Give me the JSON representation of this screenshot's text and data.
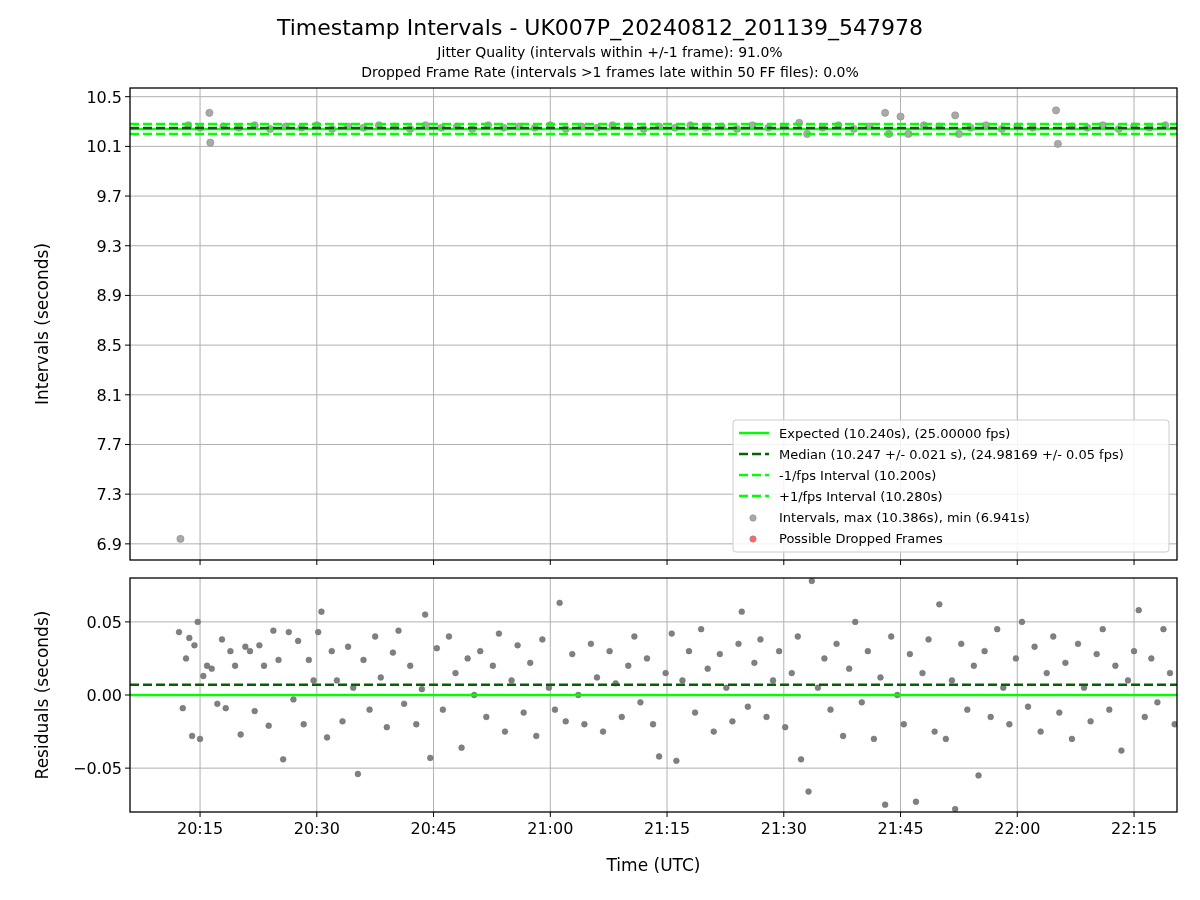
{
  "figure": {
    "title": "Timestamp Intervals - UK007P_20240812_201139_547978",
    "subtitles": [
      "Jitter Quality (intervals within +/-1 frame): 91.0%",
      "Dropped Frame Rate (intervals >1 frames late within 50 FF files): 0.0%"
    ]
  },
  "intervals_plot": {
    "chart_data": {
      "type": "scatter",
      "ylabel": "Intervals (seconds)",
      "grid": true,
      "legend": "lower right",
      "xlim": [
        20.1,
        22.342
      ],
      "ylim": [
        6.77,
        10.57
      ],
      "yticks": [
        {
          "value": 6.9,
          "label": "6.9"
        },
        {
          "value": 7.3,
          "label": "7.3"
        },
        {
          "value": 7.7,
          "label": "7.7"
        },
        {
          "value": 8.1,
          "label": "8.1"
        },
        {
          "value": 8.5,
          "label": "8.5"
        },
        {
          "value": 8.9,
          "label": "8.9"
        },
        {
          "value": 9.3,
          "label": "9.3"
        },
        {
          "value": 9.7,
          "label": "9.7"
        },
        {
          "value": 10.1,
          "label": "10.1"
        },
        {
          "value": 10.5,
          "label": "10.5"
        }
      ],
      "ref_lines": [
        {
          "axis": "y",
          "value": 10.24,
          "label": "Expected (10.240s), (25.00000 fps)",
          "color": "#00ff00"
        },
        {
          "axis": "y",
          "value": 10.247,
          "label": "Median (10.247 +/- 0.021 s), (24.98169 +/- 0.05 fps)",
          "color": "#006400"
        },
        {
          "axis": "y",
          "value": 10.2,
          "label": "-1/fps Interval (10.200s)",
          "color": "#00ff00"
        },
        {
          "axis": "y",
          "value": 10.28,
          "label": "+1/fps Interval (10.280s)",
          "color": "#00ff00"
        }
      ],
      "x": [
        20.208,
        20.225,
        20.25,
        20.27,
        20.272,
        20.3,
        20.333,
        20.367,
        20.4,
        20.433,
        20.467,
        20.5,
        20.533,
        20.567,
        20.6,
        20.633,
        20.667,
        20.7,
        20.733,
        20.767,
        20.8,
        20.833,
        20.867,
        20.9,
        20.933,
        20.967,
        21,
        21.033,
        21.067,
        21.1,
        21.133,
        21.167,
        21.2,
        21.233,
        21.267,
        21.3,
        21.333,
        21.367,
        21.4,
        21.433,
        21.467,
        21.5,
        21.533,
        21.55,
        21.583,
        21.617,
        21.65,
        21.683,
        21.717,
        21.725,
        21.75,
        21.767,
        21.8,
        21.833,
        21.867,
        21.875,
        21.9,
        21.933,
        21.967,
        22,
        22.033,
        22.083,
        22.087,
        22.117,
        22.15,
        22.183,
        22.217,
        22.25,
        22.283,
        22.317
      ],
      "series": [
        {
          "name": "Intervals, max (10.386s), min (6.941s)",
          "color": "#a9a9a9",
          "values": [
            6.94,
            10.27,
            10.25,
            10.37,
            10.13,
            10.26,
            10.25,
            10.27,
            10.24,
            10.26,
            10.25,
            10.27,
            10.24,
            10.26,
            10.25,
            10.27,
            10.26,
            10.24,
            10.27,
            10.25,
            10.26,
            10.24,
            10.27,
            10.25,
            10.26,
            10.25,
            10.27,
            10.24,
            10.26,
            10.25,
            10.27,
            10.26,
            10.24,
            10.26,
            10.25,
            10.27,
            10.25,
            10.26,
            10.24,
            10.27,
            10.25,
            10.26,
            10.29,
            10.2,
            10.25,
            10.27,
            10.24,
            10.26,
            10.37,
            10.2,
            10.34,
            10.2,
            10.27,
            10.26,
            10.35,
            10.2,
            10.25,
            10.27,
            10.24,
            10.26,
            10.25,
            10.39,
            10.12,
            10.26,
            10.25,
            10.27,
            10.24,
            10.26,
            10.25,
            10.27
          ]
        },
        {
          "name": "Possible Dropped Frames",
          "color": "#ff6666",
          "values": [
            null,
            null,
            null,
            null,
            null,
            null,
            null,
            null,
            null,
            null,
            null,
            null,
            null,
            null,
            null,
            null,
            null,
            null,
            null,
            null,
            null,
            null,
            null,
            null,
            null,
            null,
            null,
            null,
            null,
            null,
            null,
            null,
            null,
            null,
            null,
            null,
            null,
            null,
            null,
            null,
            null,
            null,
            null,
            null,
            null,
            null,
            null,
            null,
            null,
            null,
            null,
            null,
            null,
            null,
            null,
            null,
            null,
            null,
            null,
            null,
            null,
            null,
            null,
            null,
            null,
            null,
            null,
            null,
            null,
            null
          ]
        }
      ]
    }
  },
  "residuals_plot": {
    "chart_data": {
      "type": "scatter",
      "xlabel": "Time (UTC)",
      "ylabel": "Residuals (seconds)",
      "grid": true,
      "xlim": [
        20.1,
        22.342
      ],
      "ylim": [
        -0.08,
        0.08
      ],
      "yticks": [
        {
          "value": -0.05,
          "label": "−0.05"
        },
        {
          "value": 0,
          "label": "0.00"
        },
        {
          "value": 0.05,
          "label": "0.05"
        }
      ],
      "ref_lines": [
        {
          "axis": "y",
          "value": 0,
          "color": "#00ff00"
        },
        {
          "axis": "y",
          "value": 0.007,
          "color": "#006400"
        }
      ],
      "x": [
        20.205,
        20.213,
        20.22,
        20.227,
        20.233,
        20.238,
        20.245,
        20.25,
        20.257,
        20.265,
        20.275,
        20.287,
        20.297,
        20.305,
        20.315,
        20.325,
        20.337,
        20.347,
        20.357,
        20.367,
        20.377,
        20.387,
        20.397,
        20.407,
        20.418,
        20.428,
        20.44,
        20.45,
        20.46,
        20.472,
        20.483,
        20.493,
        20.503,
        20.51,
        20.522,
        20.532,
        20.543,
        20.555,
        20.567,
        20.578,
        20.588,
        20.6,
        20.613,
        20.625,
        20.637,
        20.65,
        20.663,
        20.675,
        20.687,
        20.7,
        20.713,
        20.725,
        20.732,
        20.743,
        20.757,
        20.77,
        20.783,
        20.797,
        20.81,
        20.823,
        20.837,
        20.85,
        20.863,
        20.877,
        20.89,
        20.903,
        20.917,
        20.93,
        20.943,
        20.957,
        20.97,
        20.983,
        20.997,
        21.01,
        21.02,
        21.033,
        21.047,
        21.06,
        21.073,
        21.087,
        21.1,
        21.113,
        21.127,
        21.14,
        21.153,
        21.167,
        21.18,
        21.193,
        21.207,
        21.22,
        21.233,
        21.247,
        21.26,
        21.27,
        21.283,
        21.297,
        21.31,
        21.323,
        21.337,
        21.35,
        21.363,
        21.377,
        21.39,
        21.403,
        21.41,
        21.423,
        21.437,
        21.45,
        21.463,
        21.477,
        21.49,
        21.503,
        21.517,
        21.53,
        21.537,
        21.553,
        21.56,
        21.573,
        21.587,
        21.6,
        21.613,
        21.627,
        21.64,
        21.653,
        21.667,
        21.68,
        21.693,
        21.707,
        21.717,
        21.73,
        21.743,
        21.757,
        21.77,
        21.783,
        21.797,
        21.81,
        21.823,
        21.833,
        21.847,
        21.86,
        21.867,
        21.88,
        21.893,
        21.907,
        21.917,
        21.93,
        21.943,
        21.957,
        21.97,
        21.983,
        21.997,
        22.01,
        22.023,
        22.037,
        22.05,
        22.063,
        22.077,
        22.09,
        22.103,
        22.117,
        22.13,
        22.143,
        22.157,
        22.17,
        22.183,
        22.197,
        22.21,
        22.223,
        22.237,
        22.25,
        22.26,
        22.273,
        22.287,
        22.3,
        22.313,
        22.327,
        22.337
      ],
      "xticks": [
        {
          "value": 20.25,
          "label": "20:15"
        },
        {
          "value": 20.5,
          "label": "20:30"
        },
        {
          "value": 20.75,
          "label": "20:45"
        },
        {
          "value": 21,
          "label": "21:00"
        },
        {
          "value": 21.25,
          "label": "21:15"
        },
        {
          "value": 21.5,
          "label": "21:30"
        },
        {
          "value": 21.75,
          "label": "21:45"
        },
        {
          "value": 22,
          "label": "22:00"
        },
        {
          "value": 22.25,
          "label": "22:15"
        }
      ],
      "series": [
        {
          "color": "#808080",
          "values": [
            0.043,
            -0.009,
            0.025,
            0.039,
            -0.028,
            0.034,
            0.05,
            -0.03,
            0.013,
            0.02,
            0.018,
            -0.006,
            0.038,
            -0.009,
            0.03,
            0.02,
            -0.027,
            0.033,
            0.03,
            -0.011,
            0.034,
            0.02,
            -0.021,
            0.044,
            0.024,
            -0.044,
            0.043,
            -0.003,
            0.037,
            -0.02,
            0.024,
            0.01,
            0.043,
            0.057,
            -0.029,
            0.03,
            0.01,
            -0.018,
            0.033,
            0.005,
            -0.054,
            0.024,
            -0.01,
            0.04,
            0.012,
            -0.022,
            0.029,
            0.044,
            -0.006,
            0.02,
            -0.02,
            0.004,
            0.055,
            -0.043,
            0.032,
            -0.01,
            0.04,
            0.015,
            -0.036,
            0.025,
            0.0,
            0.03,
            -0.015,
            0.02,
            0.042,
            -0.025,
            0.01,
            0.034,
            -0.012,
            0.022,
            -0.028,
            0.038,
            0.005,
            -0.01,
            0.063,
            -0.018,
            0.028,
            0.0,
            -0.02,
            0.035,
            0.012,
            -0.025,
            0.03,
            0.008,
            -0.015,
            0.02,
            0.04,
            -0.005,
            0.025,
            -0.02,
            -0.042,
            0.015,
            0.042,
            -0.045,
            0.01,
            0.03,
            -0.012,
            0.045,
            0.018,
            -0.025,
            0.028,
            0.005,
            -0.018,
            0.035,
            0.057,
            -0.008,
            0.022,
            0.038,
            -0.015,
            0.01,
            0.03,
            -0.022,
            0.015,
            0.04,
            -0.044,
            -0.066,
            0.078,
            0.005,
            0.025,
            -0.01,
            0.035,
            -0.028,
            0.018,
            0.05,
            -0.005,
            0.03,
            -0.03,
            0.012,
            -0.075,
            0.04,
            0.0,
            -0.02,
            0.028,
            -0.073,
            0.015,
            0.038,
            -0.025,
            0.062,
            -0.03,
            0.01,
            -0.078,
            0.035,
            -0.01,
            0.02,
            -0.055,
            0.03,
            -0.015,
            0.045,
            0.005,
            -0.02,
            0.025,
            0.05,
            -0.008,
            0.033,
            -0.025,
            0.015,
            0.04,
            -0.012,
            0.022,
            -0.03,
            0.035,
            0.005,
            -0.018,
            0.028,
            0.045,
            -0.01,
            0.02,
            -0.038,
            0.01,
            0.03,
            0.058,
            -0.015,
            0.025,
            -0.005,
            0.045,
            0.015,
            -0.02
          ]
        }
      ]
    }
  }
}
